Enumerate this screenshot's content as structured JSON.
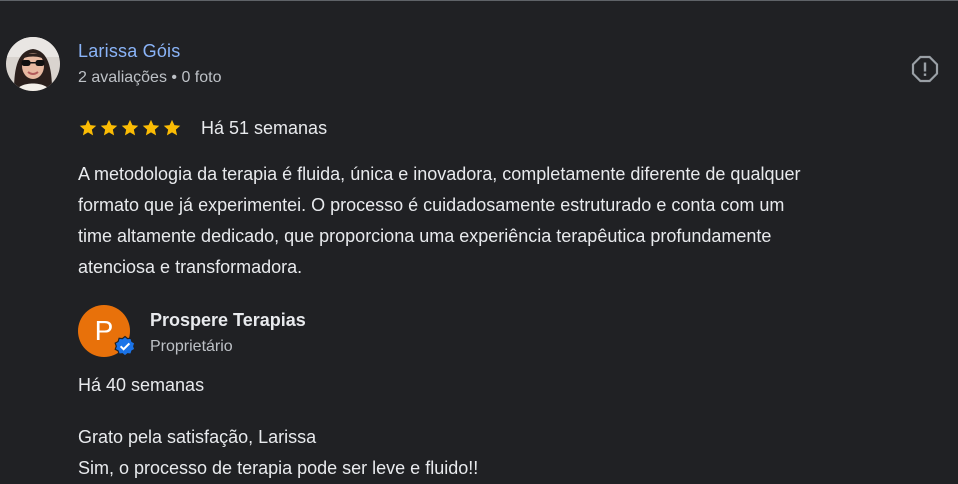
{
  "review": {
    "reviewer_name": "Larissa Góis",
    "reviewer_meta": "2 avaliações • 0 foto",
    "rating": 5,
    "rating_max": 5,
    "time": "Há 51 semanas",
    "text_lines": [
      "A metodologia da terapia é fluida, única e inovadora, completamente diferente de qualquer",
      "formato que já experimentei. O processo é cuidadosamente estruturado e conta com um",
      "time altamente dedicado, que proporciona uma experiência terapêutica profundamente",
      "atenciosa e transformadora."
    ]
  },
  "reply": {
    "owner_initial": "P",
    "owner_name": "Prospere Terapias",
    "owner_role": "Proprietário",
    "time": "Há 40 semanas",
    "text_lines": [
      "Grato pela satisfação, Larissa",
      "Sim, o processo de terapia pode ser leve e fluido!!"
    ]
  },
  "icons": {
    "report": "report-icon",
    "star": "star-icon",
    "verified": "verified-badge-icon"
  },
  "colors": {
    "background": "#202124",
    "reviewer_name": "#8ab4f8",
    "star": "#fbbc04",
    "owner_avatar": "#e8710a",
    "verified": "#1a73e8"
  }
}
